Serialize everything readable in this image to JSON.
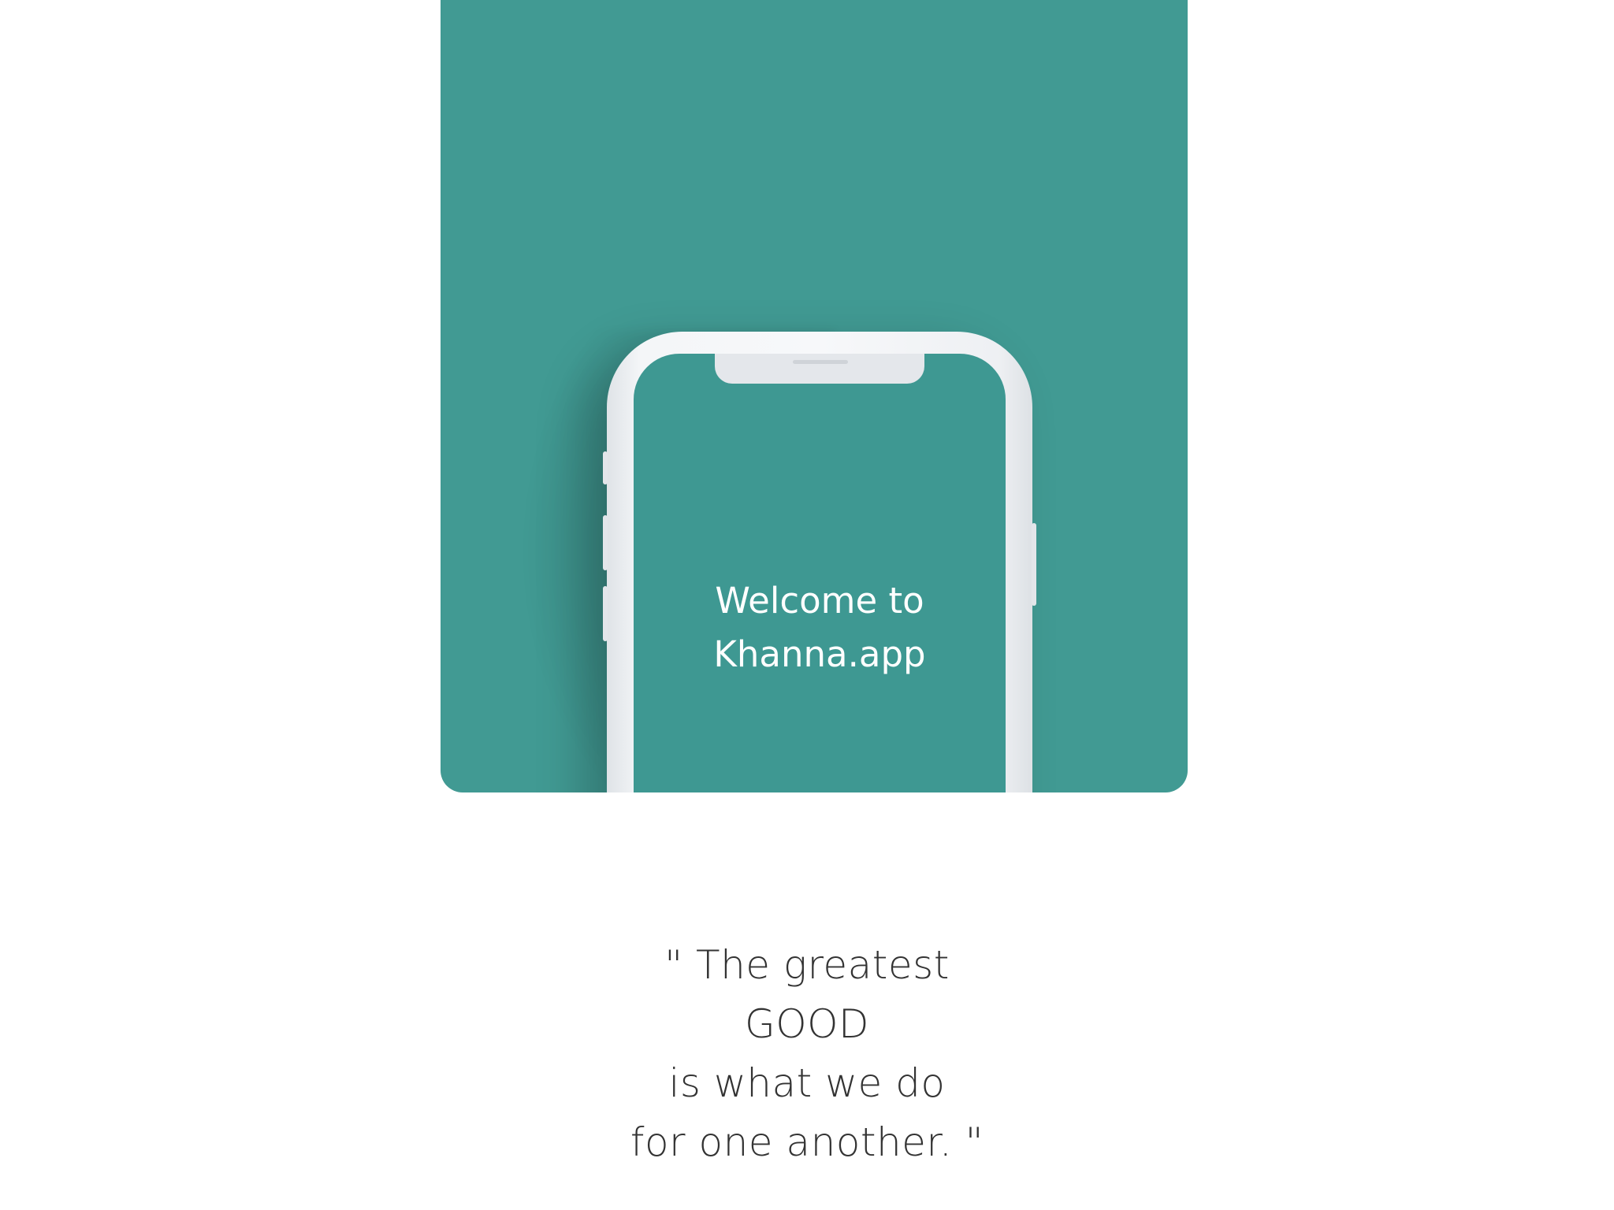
{
  "colors": {
    "card": "#419a93",
    "screen": "#3e9892",
    "phone_frame": "#f4f6f8",
    "quote_text": "#333333"
  },
  "phone_screen": {
    "welcome_line1": "Welcome to",
    "welcome_line2": "Khanna.app"
  },
  "quote": {
    "line1": "\" The greatest",
    "line2": "GOOD",
    "line3": "is what we do",
    "line4": "for one another. \""
  }
}
